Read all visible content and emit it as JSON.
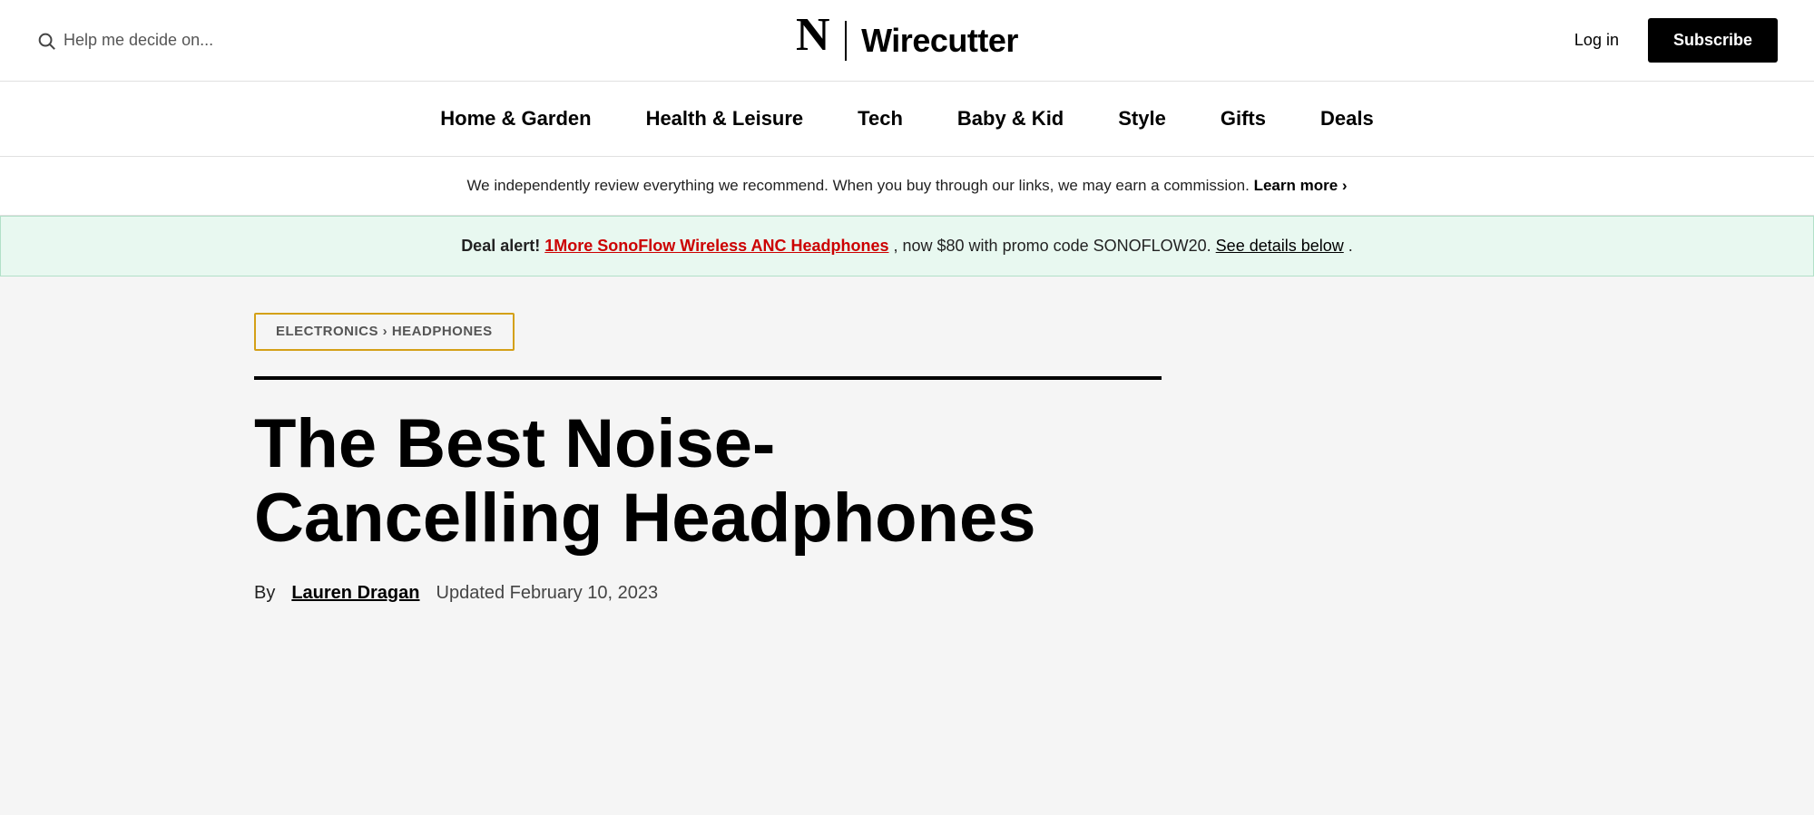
{
  "header": {
    "search_placeholder": "Help me decide on...",
    "logo_nyt": "𝔑",
    "logo_wirecutter": "Wirecutter",
    "login_label": "Log in",
    "subscribe_label": "Subscribe"
  },
  "nav": {
    "items": [
      {
        "label": "Home & Garden",
        "id": "home-garden"
      },
      {
        "label": "Health & Leisure",
        "id": "health-leisure"
      },
      {
        "label": "Tech",
        "id": "tech"
      },
      {
        "label": "Baby & Kid",
        "id": "baby-kid"
      },
      {
        "label": "Style",
        "id": "style"
      },
      {
        "label": "Gifts",
        "id": "gifts"
      },
      {
        "label": "Deals",
        "id": "deals"
      }
    ]
  },
  "disclaimer": {
    "text": "We independently review everything we recommend. When you buy through our links, we may earn a commission.",
    "learn_more_label": "Learn more ›"
  },
  "deal_alert": {
    "label": "Deal alert!",
    "deal_product": "1More SonoFlow Wireless ANC Headphones",
    "deal_text": ", now $80 with promo code SONOFLOW20.",
    "see_details_label": "See details below",
    "period": "."
  },
  "breadcrumb": {
    "text": "ELECTRONICS › HEADPHONES"
  },
  "article": {
    "title": "The Best Noise-Cancelling Headphones",
    "byline_by": "By",
    "author": "Lauren Dragan",
    "date_label": "Updated February 10, 2023"
  }
}
